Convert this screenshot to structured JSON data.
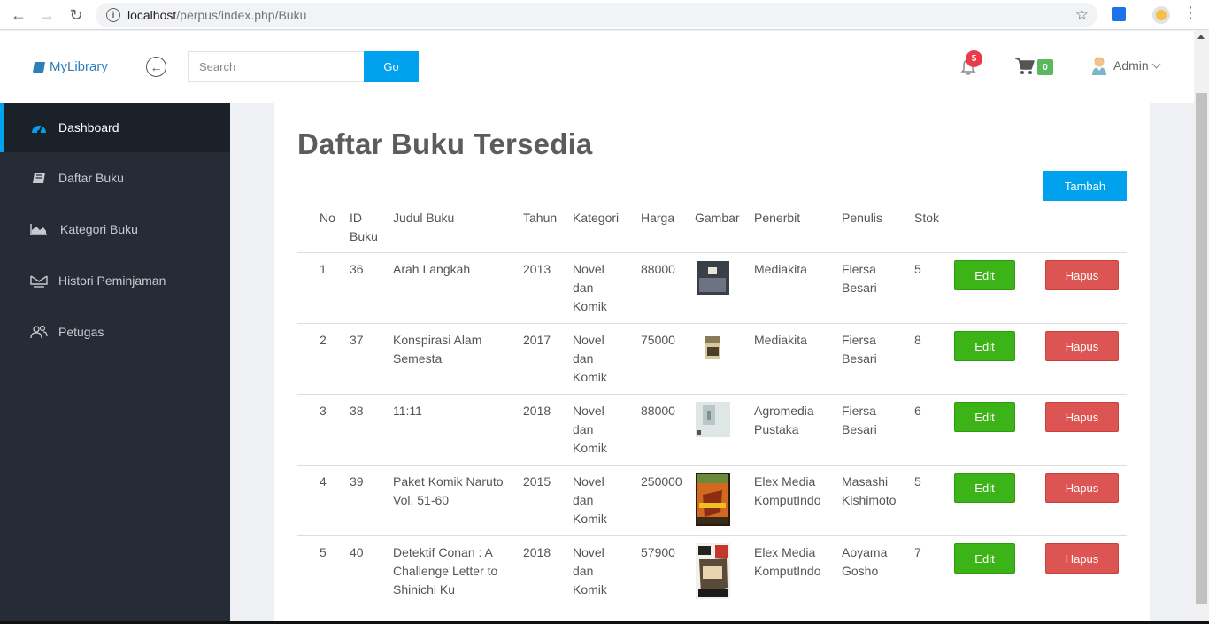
{
  "browser": {
    "url_host": "localhost",
    "url_path": "/perpus/index.php/Buku"
  },
  "header": {
    "brand": "MyLibrary",
    "search_placeholder": "Search",
    "go_label": "Go",
    "notif_count": "5",
    "cart_count": "0",
    "user": "Admin"
  },
  "sidebar": {
    "items": [
      {
        "label": "Dashboard",
        "icon": "dashboard-icon"
      },
      {
        "label": "Daftar Buku",
        "icon": "book-icon"
      },
      {
        "label": "Kategori Buku",
        "icon": "chart-icon"
      },
      {
        "label": "Histori Peminjaman",
        "icon": "history-icon"
      },
      {
        "label": "Petugas",
        "icon": "users-icon"
      }
    ]
  },
  "main": {
    "title": "Daftar Buku Tersedia",
    "add_label": "Tambah",
    "columns": [
      "No",
      "ID Buku",
      "Judul Buku",
      "Tahun",
      "Kategori",
      "Harga",
      "Gambar",
      "Penerbit",
      "Penulis",
      "Stok"
    ],
    "edit_label": "Edit",
    "delete_label": "Hapus",
    "rows": [
      {
        "no": "1",
        "id": "36",
        "judul": "Arah Langkah",
        "tahun": "2013",
        "kategori": "Novel dan Komik",
        "harga": "88000",
        "penerbit": "Mediakita",
        "penulis": "Fiersa Besari",
        "stok": "5",
        "cover": "#3a3f45"
      },
      {
        "no": "2",
        "id": "37",
        "judul": "Konspirasi Alam Semesta",
        "tahun": "2017",
        "kategori": "Novel dan Komik",
        "harga": "75000",
        "penerbit": "Mediakita",
        "penulis": "Fiersa Besari",
        "stok": "8",
        "cover": "#b9a67a"
      },
      {
        "no": "3",
        "id": "38",
        "judul": "11:11",
        "tahun": "2018",
        "kategori": "Novel dan Komik",
        "harga": "88000",
        "penerbit": "Agromedia Pustaka",
        "penulis": "Fiersa Besari",
        "stok": "6",
        "cover": "#c9d3d4"
      },
      {
        "no": "4",
        "id": "39",
        "judul": "Paket Komik Naruto Vol. 51-60",
        "tahun": "2015",
        "kategori": "Novel dan Komik",
        "harga": "250000",
        "penerbit": "Elex Media KomputIndo",
        "penulis": "Masashi Kishimoto",
        "stok": "5",
        "cover": "#d2691e"
      },
      {
        "no": "5",
        "id": "40",
        "judul": "Detektif Conan : A Challenge Letter to Shinichi Ku",
        "tahun": "2018",
        "kategori": "Novel dan Komik",
        "harga": "57900",
        "penerbit": "Elex Media KomputIndo",
        "penulis": "Aoyama Gosho",
        "stok": "7",
        "cover": "#5a4a3a"
      }
    ]
  }
}
